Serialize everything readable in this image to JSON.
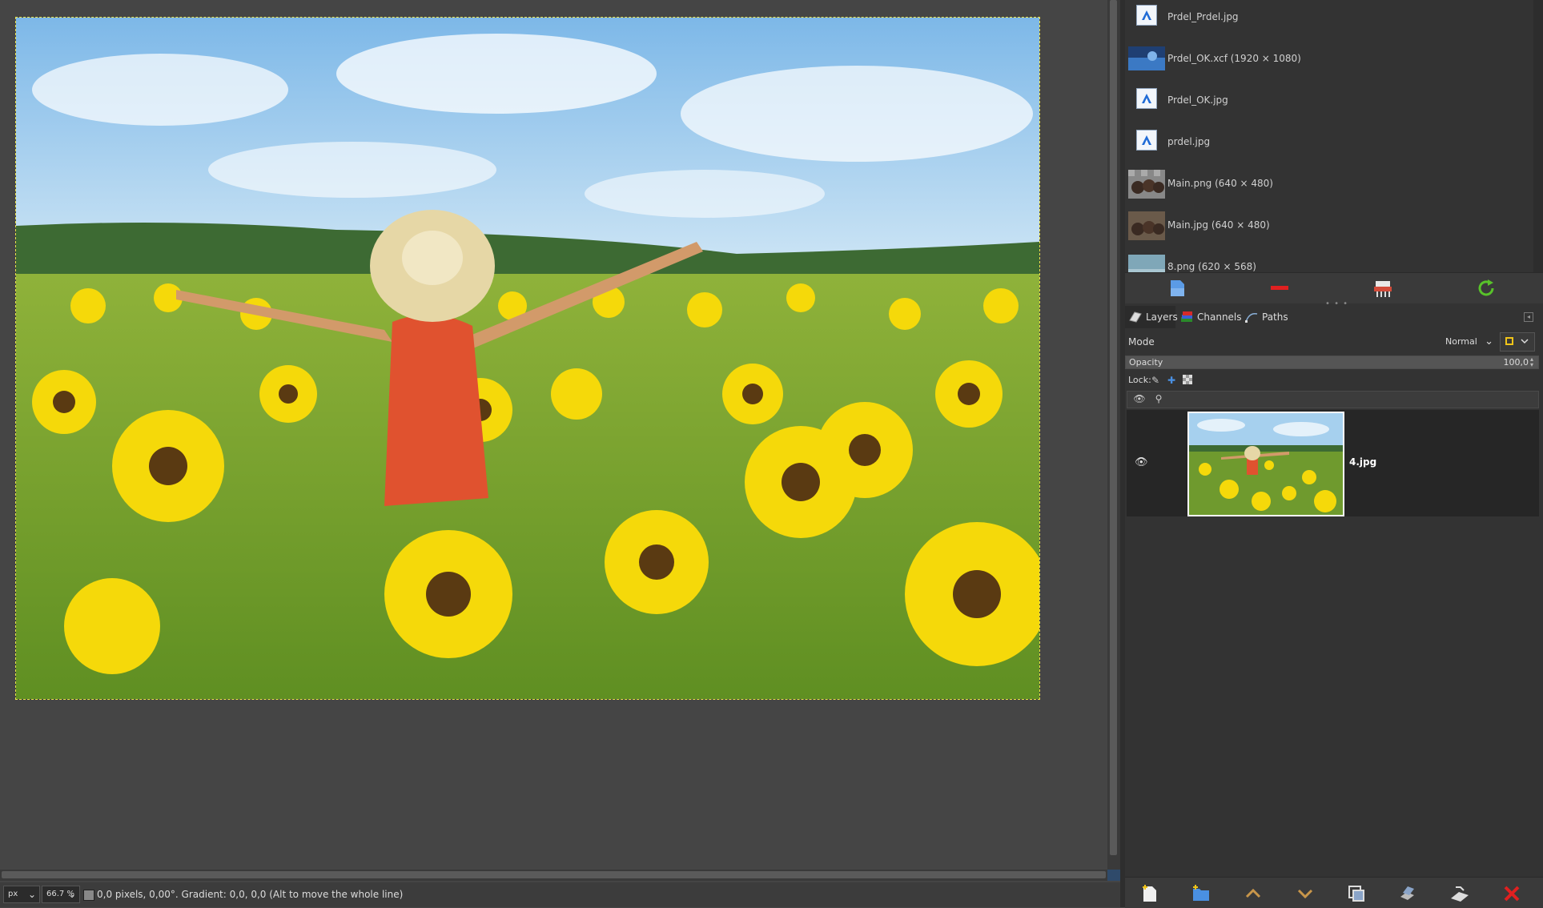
{
  "canvas": {
    "image_description_alt": "",
    "colors": {
      "sky": "#8cc3ea",
      "leaf": "#6a9a2a",
      "sunflower": "#f5d90a"
    }
  },
  "status": {
    "unit": "px",
    "zoom": "66.7 %",
    "message": "0,0 pixels, 0,00°. Gradient: 0,0, 0,0 (Alt to move the whole line)"
  },
  "images": {
    "items": [
      {
        "label": "Prdel_Prdel.jpg",
        "kind": "doc"
      },
      {
        "label": "Prdel_OK.xcf (1920 × 1080)",
        "kind": "thumb"
      },
      {
        "label": "Prdel_OK.jpg",
        "kind": "doc"
      },
      {
        "label": "prdel.jpg",
        "kind": "doc"
      },
      {
        "label": "Main.png (640 × 480)",
        "kind": "thumb"
      },
      {
        "label": "Main.jpg (640 × 480)",
        "kind": "thumb"
      },
      {
        "label": "8.png (620 × 568)",
        "kind": "thumb"
      }
    ]
  },
  "tabs": [
    {
      "label": "Layers",
      "active": true
    },
    {
      "label": "Channels",
      "active": false
    },
    {
      "label": "Paths",
      "active": false
    }
  ],
  "layers_panel": {
    "mode_label": "Mode",
    "mode_value": "Normal",
    "opacity_label": "Opacity",
    "opacity_value": "100,0",
    "opacity_fraction": 1.0,
    "lock_label": "Lock:",
    "layers": [
      {
        "name": "4.jpg",
        "visible": true
      }
    ]
  }
}
